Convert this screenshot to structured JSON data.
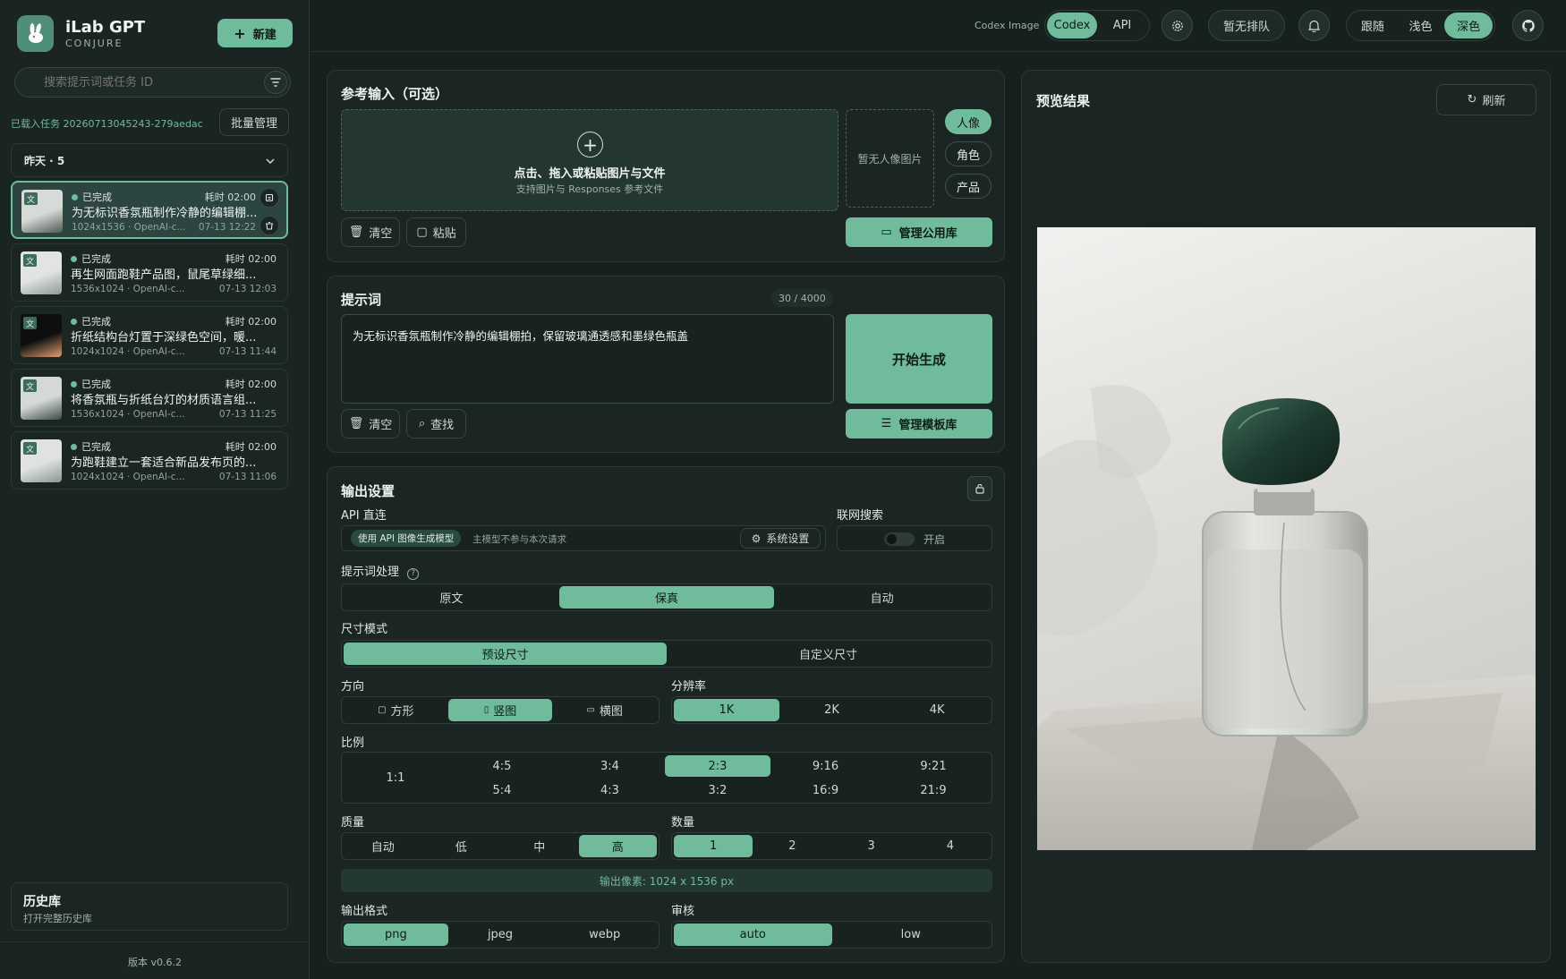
{
  "app": {
    "name": "iLab GPT",
    "sub": "CONJURE",
    "new_label": "新建"
  },
  "search": {
    "placeholder": "搜索提示词或任务 ID"
  },
  "loaded": {
    "text": "已载入任务 20260713045243-279aedac",
    "batch_label": "批量管理"
  },
  "group": {
    "label": "昨天 · 5"
  },
  "tasks": [
    {
      "status": "已完成",
      "time": "耗时 02:00",
      "title": "为无标识香氛瓶制作冷静的编辑棚...",
      "meta": "1024x1536 · OpenAI-c...",
      "date": "07-13 12:22",
      "badge": "文"
    },
    {
      "status": "已完成",
      "time": "耗时 02:00",
      "title": "再生网面跑鞋产品图，鼠尾草绿细...",
      "meta": "1536x1024 · OpenAI-c...",
      "date": "07-13 12:03",
      "badge": "文"
    },
    {
      "status": "已完成",
      "time": "耗时 02:00",
      "title": "折纸结构台灯置于深绿色空间，暖...",
      "meta": "1024x1024 · OpenAI-c...",
      "date": "07-13 11:44",
      "badge": "文"
    },
    {
      "status": "已完成",
      "time": "耗时 02:00",
      "title": "将香氛瓶与折纸台灯的材质语言组...",
      "meta": "1536x1024 · OpenAI-c...",
      "date": "07-13 11:25",
      "badge": "文"
    },
    {
      "status": "已完成",
      "time": "耗时 02:00",
      "title": "为跑鞋建立一套适合新品发布页的...",
      "meta": "1024x1024 · OpenAI-c...",
      "date": "07-13 11:06",
      "badge": "文"
    }
  ],
  "history": {
    "title": "历史库",
    "sub": "打开完整历史库"
  },
  "version": "版本 v0.6.2",
  "topbar": {
    "mode_label": "Codex Image",
    "codex": "Codex",
    "api": "API",
    "queue": "暂无排队",
    "theme_follow": "跟随",
    "theme_light": "浅色",
    "theme_dark": "深色"
  },
  "ref": {
    "title": "参考输入（可选）",
    "drop_main": "点击、拖入或粘贴图片与文件",
    "drop_sub": "支持图片与 Responses 参考文件",
    "no_portrait": "暂无人像图片",
    "chips": [
      "人像",
      "角色",
      "产品"
    ],
    "clear": "清空",
    "paste": "粘贴",
    "manage_lib": "管理公用库"
  },
  "prompt": {
    "title": "提示词",
    "count": "30 / 4000",
    "text": "为无标识香氛瓶制作冷静的编辑棚拍，保留玻璃通透感和墨绿色瓶盖",
    "generate": "开始生成",
    "clear": "清空",
    "find": "查找",
    "manage_tpl": "管理模板库"
  },
  "output": {
    "title": "输出设置",
    "api_direct": "API 直连",
    "api_tag": "使用 API 图像生成模型",
    "api_note": "主模型不参与本次请求",
    "sys_settings": "系统设置",
    "web_search": "联网搜索",
    "web_toggle": "开启",
    "prompt_proc": "提示词处理",
    "proc_opts": [
      "原文",
      "保真",
      "自动"
    ],
    "size_mode": "尺寸模式",
    "size_opts": [
      "预设尺寸",
      "自定义尺寸"
    ],
    "direction": "方向",
    "dir_opts": [
      "方形",
      "竖图",
      "横图"
    ],
    "resolution": "分辨率",
    "res_opts": [
      "1K",
      "2K",
      "4K"
    ],
    "ratio": "比例",
    "ratio_1to1": "1:1",
    "ratio_top": [
      "4:5",
      "3:4",
      "2:3",
      "9:16",
      "9:21"
    ],
    "ratio_bottom": [
      "5:4",
      "4:3",
      "3:2",
      "16:9",
      "21:9"
    ],
    "quality": "质量",
    "q_opts": [
      "自动",
      "低",
      "中",
      "高"
    ],
    "count": "数量",
    "n_opts": [
      "1",
      "2",
      "3",
      "4"
    ],
    "pixels": "输出像素: 1024 x 1536 px",
    "format": "输出格式",
    "fmt_opts": [
      "png",
      "jpeg",
      "webp"
    ],
    "review": "审核",
    "rev_opts": [
      "auto",
      "low"
    ]
  },
  "preview": {
    "title": "预览结果",
    "refresh": "刷新"
  },
  "colors": {
    "accent": "#6fbb9c",
    "bg": "#16211f",
    "panel": "#1b2624"
  }
}
